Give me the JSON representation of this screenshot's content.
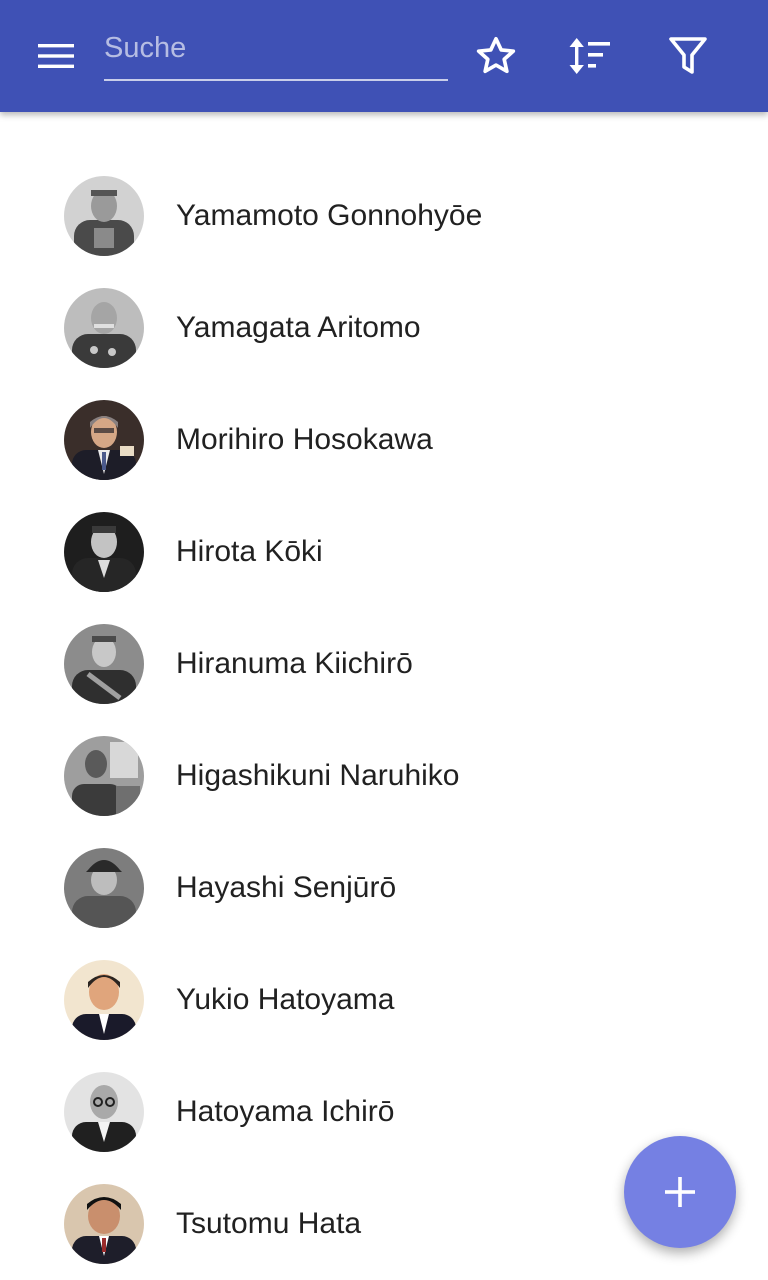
{
  "toolbar": {
    "search_placeholder": "Suche",
    "search_value": "",
    "icons": [
      "menu-icon",
      "star-icon",
      "sort-icon",
      "filter-icon"
    ],
    "background_color": "#3f51b5"
  },
  "people": [
    {
      "name": "Yamamoto Gonnohyōe",
      "photo": "grayscale portrait"
    },
    {
      "name": "Yamagata Aritomo",
      "photo": "grayscale portrait"
    },
    {
      "name": "Morihiro Hosokawa",
      "photo": "color portrait"
    },
    {
      "name": "Hirota Kōki",
      "photo": "grayscale portrait"
    },
    {
      "name": "Hiranuma Kiichirō",
      "photo": "grayscale portrait"
    },
    {
      "name": "Higashikuni Naruhiko",
      "photo": "grayscale portrait"
    },
    {
      "name": "Hayashi Senjūrō",
      "photo": "grayscale portrait"
    },
    {
      "name": "Yukio Hatoyama",
      "photo": "color portrait"
    },
    {
      "name": "Hatoyama Ichirō",
      "photo": "grayscale portrait"
    },
    {
      "name": "Tsutomu Hata",
      "photo": "color portrait"
    }
  ],
  "fab": {
    "icon": "plus-icon",
    "color": "#7580e3"
  }
}
